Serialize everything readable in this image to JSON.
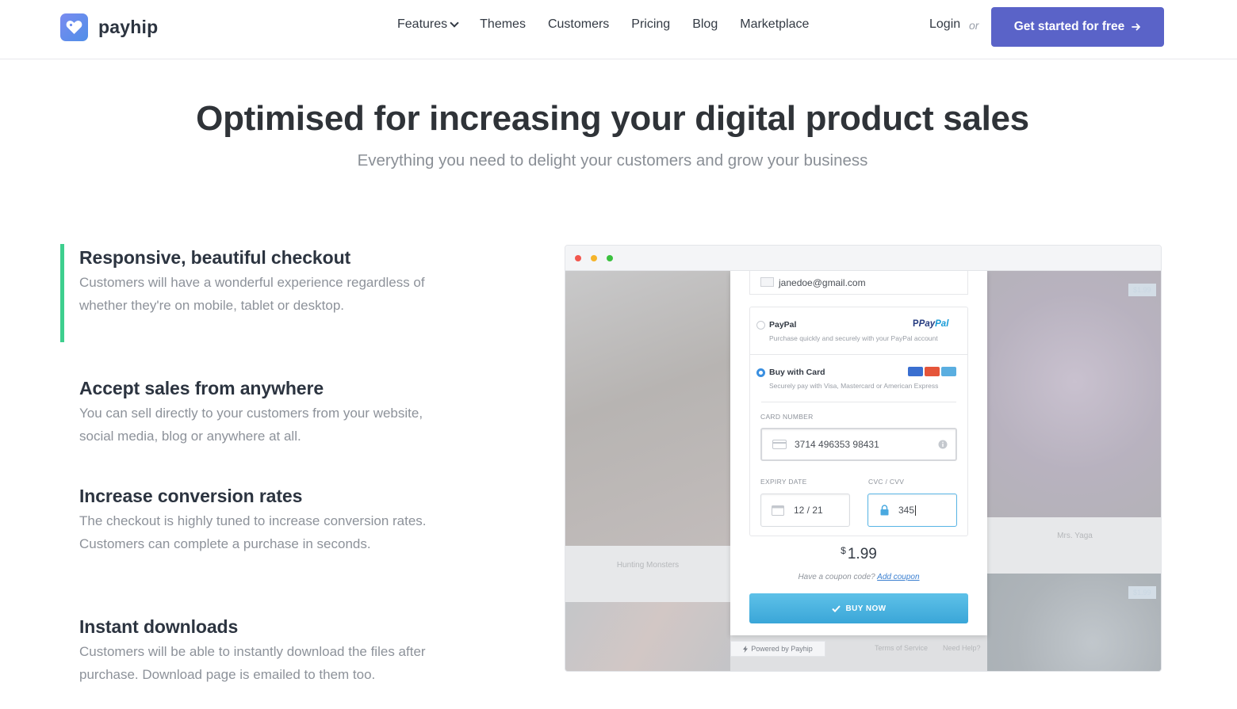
{
  "brand": {
    "name": "payhip"
  },
  "nav": {
    "items": [
      {
        "label": "Features",
        "dropdown": true
      },
      {
        "label": "Themes"
      },
      {
        "label": "Customers"
      },
      {
        "label": "Pricing"
      },
      {
        "label": "Blog"
      },
      {
        "label": "Marketplace"
      }
    ],
    "login": "Login",
    "or": "or",
    "cta": "Get started for free"
  },
  "hero": {
    "title": "Optimised for increasing your digital product sales",
    "subtitle": "Everything you need to delight your customers and grow your business"
  },
  "features": [
    {
      "title": "Responsive, beautiful checkout",
      "body": "Customers will have a wonderful experience regardless of whether they're on mobile, tablet or desktop.",
      "active": true
    },
    {
      "title": "Accept sales from anywhere",
      "body": "You can sell directly to your customers from your website, social media, blog or anywhere at all."
    },
    {
      "title": "Increase conversion rates",
      "body": "The checkout is highly tuned to increase conversion rates. Customers can complete a purchase in seconds."
    },
    {
      "title": "Instant downloads",
      "body": "Customers will be able to instantly download the files after purchase. Download page is emailed to them too."
    }
  ],
  "mockup": {
    "books": {
      "left_caption": "Hunting Monsters",
      "right_caption": "Mrs. Yaga",
      "right_price": "$1.99",
      "bottom_right_price": "$1.99"
    },
    "checkout": {
      "email": "janedoe@gmail.com",
      "paypal": {
        "title": "PayPal",
        "desc": "Purchase quickly and securely with your PayPal account",
        "logo_a": "Pay",
        "logo_b": "Pal"
      },
      "card": {
        "title": "Buy with Card",
        "desc": "Securely pay with Visa, Mastercard or American Express"
      },
      "card_number_label": "CARD NUMBER",
      "card_number": "3714 496353 98431",
      "expiry_label": "EXPIRY DATE",
      "expiry": "12 / 21",
      "cvc_label": "CVC / CVV",
      "cvc": "345",
      "currency": "$",
      "amount": "1.99",
      "coupon_prompt": "Have a coupon code?",
      "coupon_link": "Add coupon",
      "buy_label": "BUY NOW",
      "powered": "Powered by Payhip",
      "terms": "Terms of Service",
      "help": "Need Help?"
    }
  },
  "colors": {
    "accent": "#5a63c8",
    "feature_active": "#3ecf8e",
    "buy": "#3aa6d8"
  }
}
